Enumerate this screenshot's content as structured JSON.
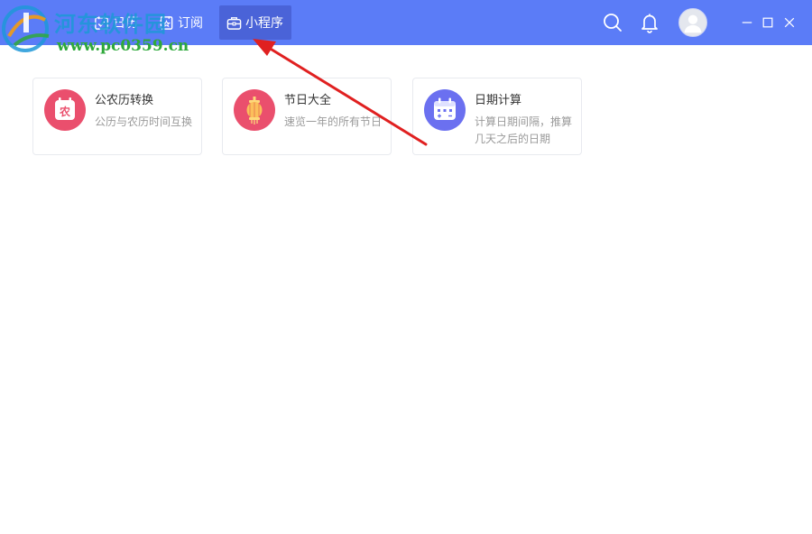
{
  "nav": {
    "tabs": [
      {
        "label": "日历",
        "icon": "calendar-check-icon"
      },
      {
        "label": "订阅",
        "icon": "subscribe-icon"
      },
      {
        "label": "小程序",
        "icon": "toolbox-icon",
        "active": true
      }
    ]
  },
  "toolbar": {
    "icons": [
      "search-icon",
      "bell-icon",
      "user-avatar-icon"
    ]
  },
  "window_controls": [
    "minimize-icon",
    "maximize-icon",
    "close-icon"
  ],
  "cards": [
    {
      "title": "公农历转换",
      "desc": "公历与农历时间互换",
      "icon_char": "农",
      "icon": "lunar-calendar-icon",
      "color": "#ea4f6d"
    },
    {
      "title": "节日大全",
      "desc": "速览一年的所有节日",
      "icon": "lantern-icon",
      "color": "#ea4f6d"
    },
    {
      "title": "日期计算",
      "desc": "计算日期间隔，推算几天之后的日期",
      "icon": "date-calculator-icon",
      "color": "#6b70f0"
    }
  ],
  "watermark": {
    "title": "河东软件园",
    "url": "www.pc0359.cn"
  },
  "colors": {
    "topbar": "#5b7cf7",
    "active_tab": "#4a63d8",
    "annotation_arrow": "#e02020"
  }
}
